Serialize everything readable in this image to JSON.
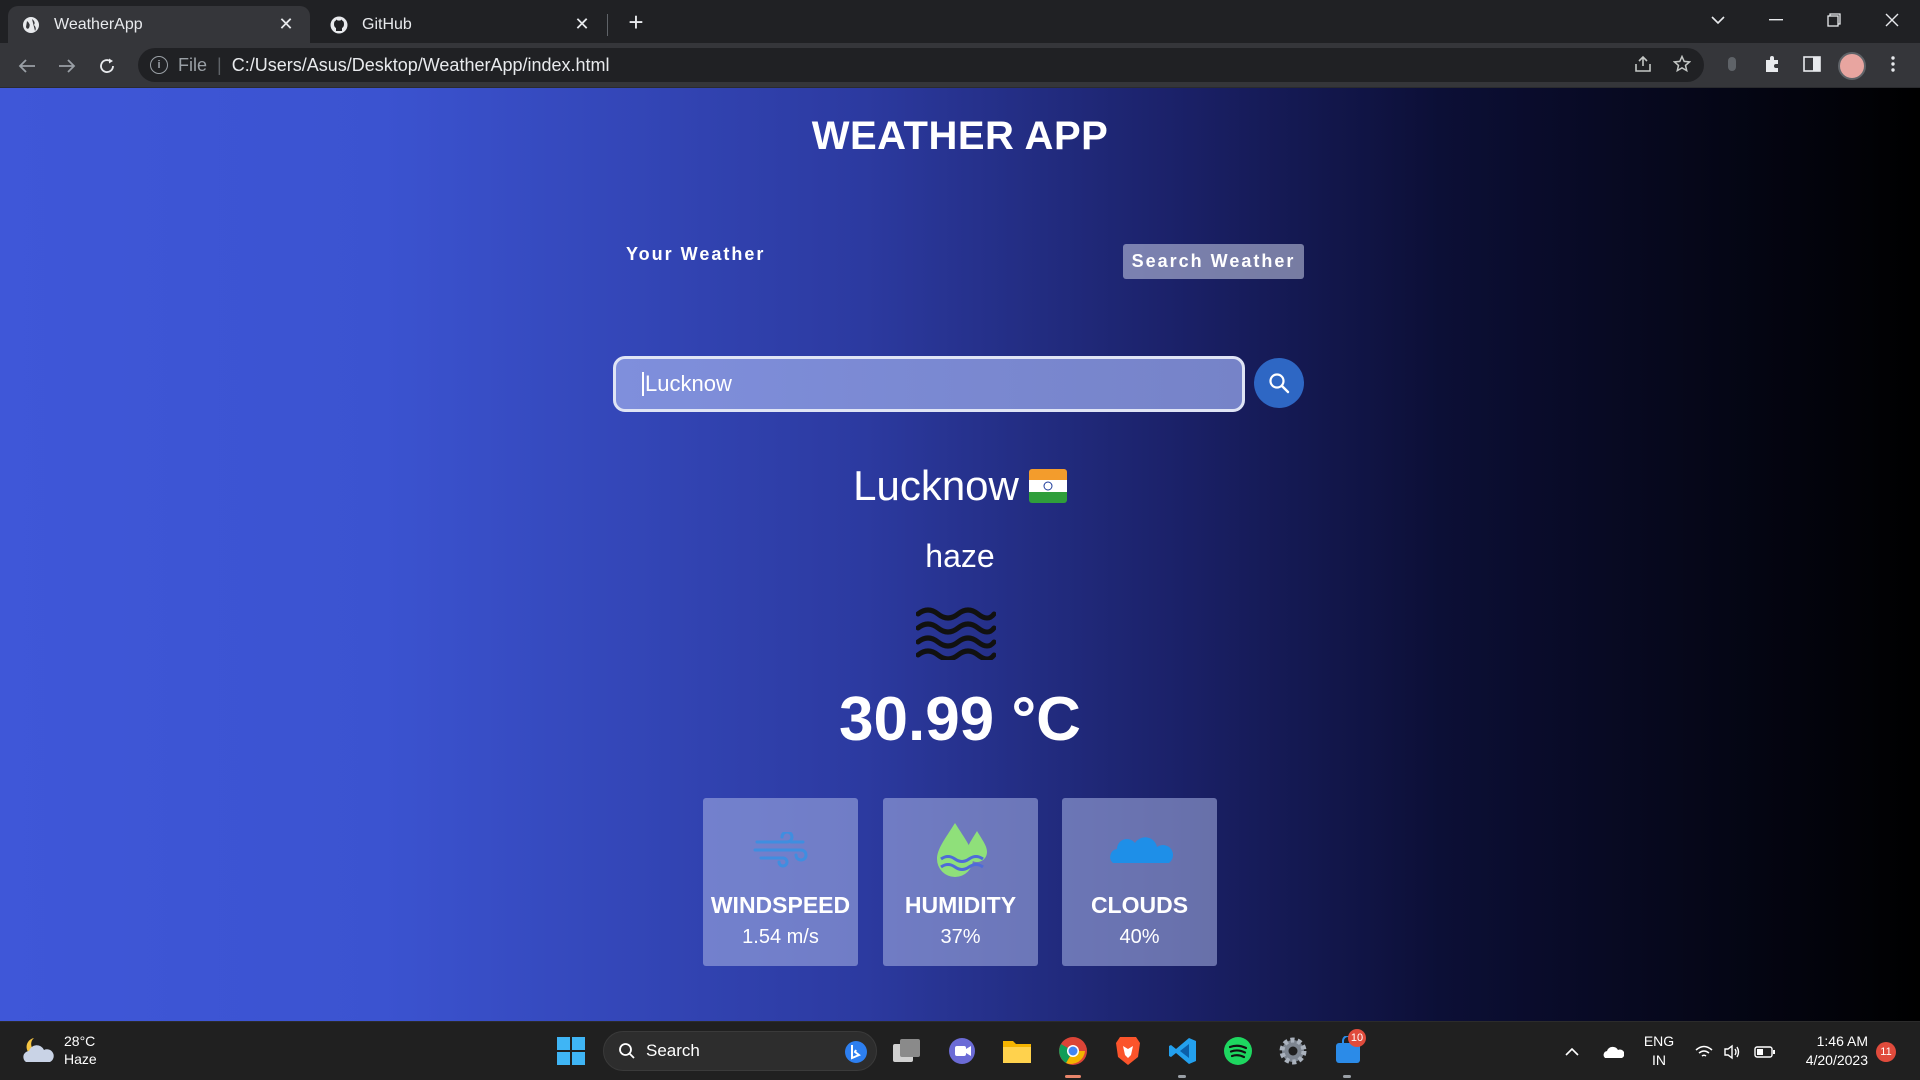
{
  "browser": {
    "tabs": [
      {
        "title": "WeatherApp",
        "active": true
      },
      {
        "title": "GitHub",
        "active": false
      }
    ],
    "address": {
      "scheme": "File",
      "path": "C:/Users/Asus/Desktop/WeatherApp/index.html"
    }
  },
  "app": {
    "title": "WEATHER APP",
    "tabs": {
      "your_weather": "Your Weather",
      "search_weather": "Search Weather"
    },
    "search": {
      "value": "Lucknow"
    },
    "city": "Lucknow",
    "country_flag": "india-flag",
    "description": "haze",
    "condition_icon": "haze-icon",
    "temperature": "30.99 °C",
    "stats": [
      {
        "label": "WINDSPEED",
        "value": "1.54 m/s",
        "icon": "wind-icon"
      },
      {
        "label": "HUMIDITY",
        "value": "37%",
        "icon": "humidity-icon"
      },
      {
        "label": "CLOUDS",
        "value": "40%",
        "icon": "cloud-icon"
      }
    ]
  },
  "taskbar": {
    "weather": {
      "temp": "28°C",
      "condition": "Haze"
    },
    "search_label": "Search",
    "teams_badge": "10",
    "language": {
      "line1": "ENG",
      "line2": "IN"
    },
    "clock": {
      "time": "1:46 AM",
      "date": "4/20/2023"
    },
    "notifications": "11"
  },
  "colors": {
    "accent": "#2e67c4",
    "page_gradient_start": "#3f57d8",
    "page_gradient_end": "#000000"
  }
}
